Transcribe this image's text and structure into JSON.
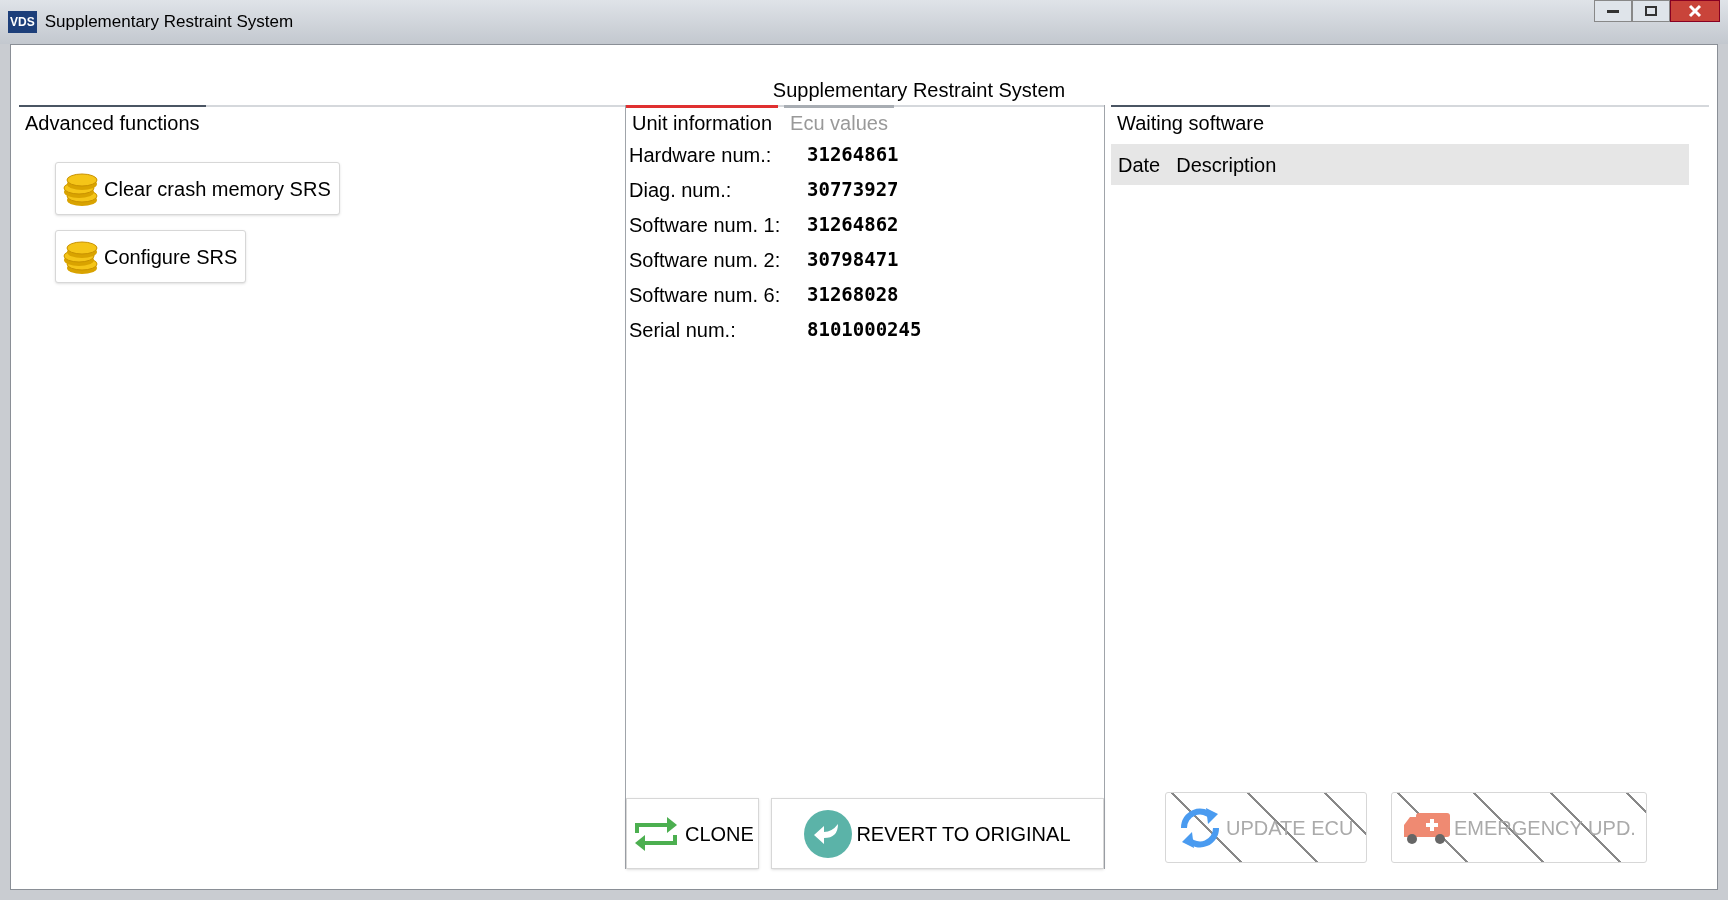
{
  "window": {
    "app_icon_text": "VDS",
    "title": "Supplementary Restraint System"
  },
  "page_title": "Supplementary Restraint System",
  "advanced": {
    "heading": "Advanced functions",
    "buttons": [
      {
        "label": "Clear crash memory SRS"
      },
      {
        "label": "Configure SRS"
      }
    ]
  },
  "unit": {
    "tabs": [
      {
        "label": "Unit information",
        "selected": true
      },
      {
        "label": "Ecu values",
        "selected": false
      }
    ],
    "rows": [
      {
        "label": "Hardware num.:",
        "value": "31264861"
      },
      {
        "label": "Diag. num.:",
        "value": "30773927"
      },
      {
        "label": "Software num. 1:",
        "value": "31264862"
      },
      {
        "label": "Software num. 2:",
        "value": "30798471"
      },
      {
        "label": "Software num. 6:",
        "value": "31268028"
      },
      {
        "label": "Serial num.:",
        "value": "8101000245"
      }
    ],
    "buttons": [
      {
        "kind": "clone",
        "label": "CLONE"
      },
      {
        "kind": "revert",
        "label": "REVERT TO ORIGINAL"
      }
    ]
  },
  "waiting": {
    "heading": "Waiting software",
    "columns": [
      "Date",
      "Description"
    ],
    "buttons": [
      {
        "kind": "update",
        "label": "UPDATE ECU",
        "disabled": true
      },
      {
        "kind": "emergency",
        "label": "EMERGENCY UPD.",
        "disabled": true
      }
    ]
  }
}
